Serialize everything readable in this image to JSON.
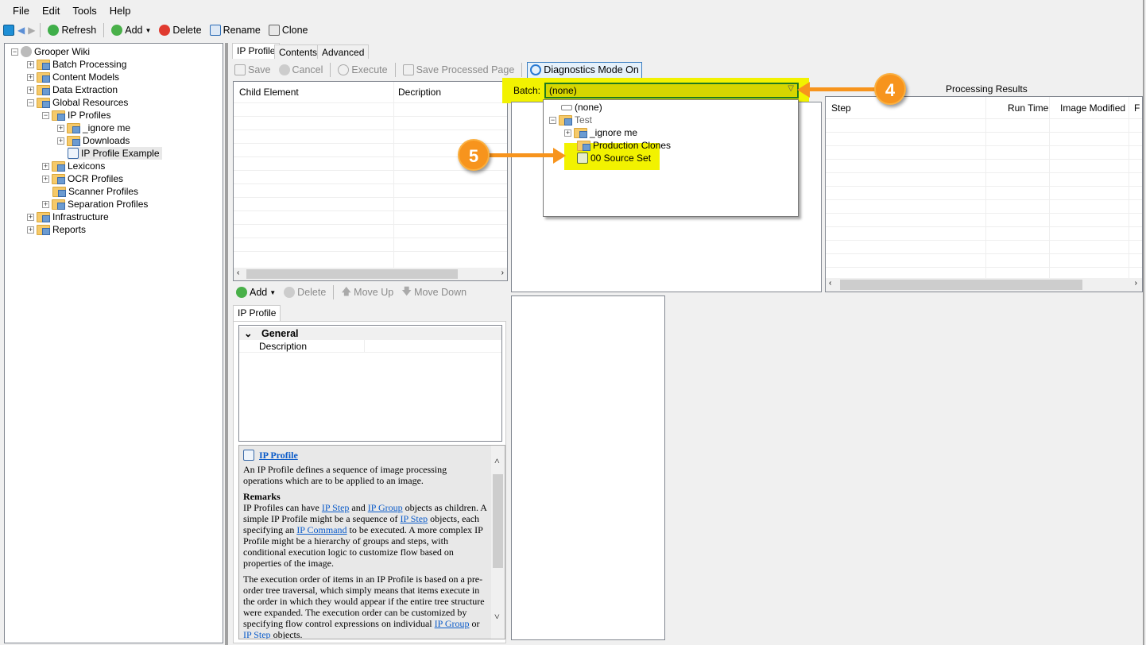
{
  "menu": [
    "File",
    "Edit",
    "Tools",
    "Help"
  ],
  "toolbar": {
    "refresh": "Refresh",
    "add": "Add",
    "delete": "Delete",
    "rename": "Rename",
    "clone": "Clone"
  },
  "tree": {
    "root": "Grooper Wiki",
    "items": [
      "Batch Processing",
      "Content Models",
      "Data Extraction",
      "Global Resources",
      "IP Profiles",
      "_ignore me",
      "Downloads",
      "IP Profile Example",
      "Lexicons",
      "OCR Profiles",
      "Scanner Profiles",
      "Separation Profiles",
      "Infrastructure",
      "Reports"
    ]
  },
  "tabs": [
    "IP Profile",
    "Contents",
    "Advanced"
  ],
  "editor_toolbar": {
    "save": "Save",
    "cancel": "Cancel",
    "execute": "Execute",
    "save_page": "Save Processed Page",
    "diagnostics": "Diagnostics Mode On"
  },
  "child_grid": {
    "columns": [
      "Child Element",
      "Decription"
    ]
  },
  "lower_toolbar": {
    "add": "Add",
    "delete": "Delete",
    "move_up": "Move Up",
    "move_down": "Move Down"
  },
  "prop_tab": "IP Profile",
  "props": {
    "category": "General",
    "rows": [
      "Description"
    ]
  },
  "help": {
    "title": "IP Profile",
    "intro": "An IP Profile defines a sequence of image processing operations which are to be applied to an image.",
    "remarks": "Remarks",
    "p1a": "IP Profiles can have ",
    "l1": "IP Step",
    "p1b": " and ",
    "l2": "IP Group",
    "p1c": " objects as children. A simple IP Profile might be a sequence of ",
    "l3": "IP Step",
    "p1d": " objects, each specifying an ",
    "l4": "IP Command",
    "p1e": " to be executed. A more complex IP Profile might be a hierarchy of groups and steps, with conditional execution logic to customize flow based on properties of the image.",
    "p2a": "The execution order of items in an IP Profile is based on a pre-order tree traversal, which simply means that items execute in the order in which they would appear if the entire tree structure were expanded. The execution order can be customized by specifying flow control expressions on individual ",
    "l5": "IP Group",
    "p2b": " or ",
    "l6": "IP Step",
    "p2c": " objects."
  },
  "batch": {
    "label": "Batch:",
    "value": "(none)",
    "options": [
      "(none)",
      "Test",
      "_ignore me",
      "Production Clones",
      "00 Source Set"
    ]
  },
  "results": {
    "title": "Processing Results",
    "columns": [
      "Step",
      "Run Time",
      "Image Modified",
      "F"
    ]
  },
  "callouts": [
    "4",
    "5"
  ],
  "colors": {
    "highlight": "#f2f200",
    "callout": "#f7941d",
    "link": "#0b5bc9"
  }
}
